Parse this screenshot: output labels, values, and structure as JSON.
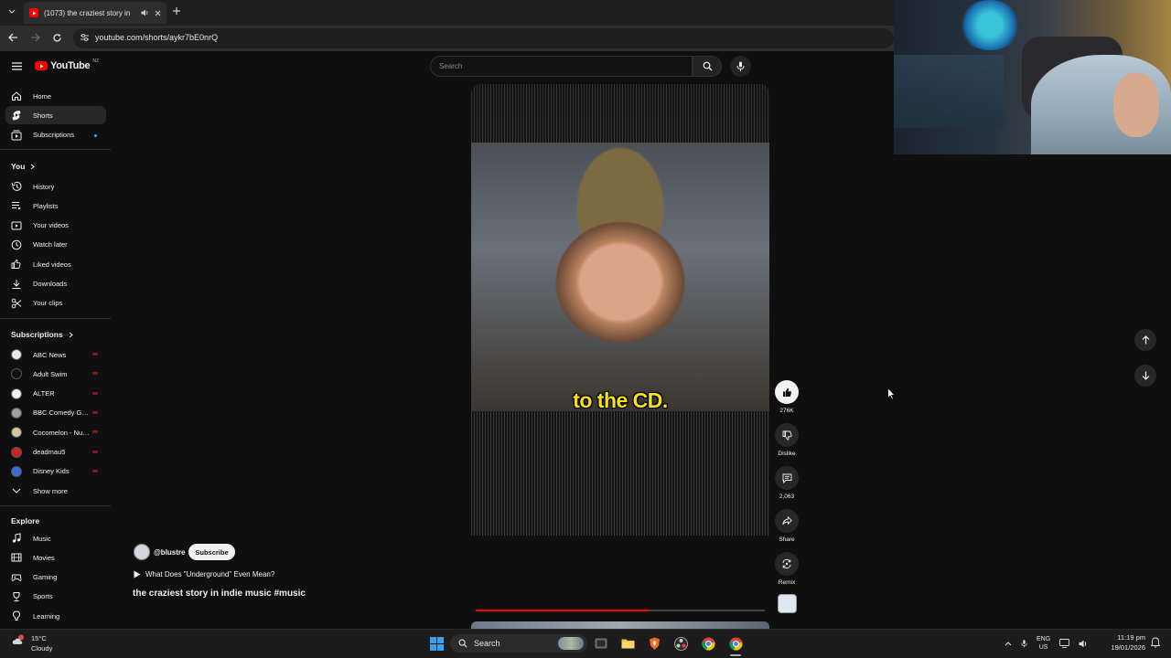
{
  "browser": {
    "tab_title": "(1073) the craziest story in",
    "url": "youtube.com/shorts/aykr7bE0nrQ"
  },
  "youtube": {
    "logo_text": "YouTube",
    "region": "NZ",
    "search_placeholder": "Search"
  },
  "sidebar": {
    "main": [
      {
        "label": "Home",
        "icon": "home-icon"
      },
      {
        "label": "Shorts",
        "icon": "shorts-icon"
      },
      {
        "label": "Subscriptions",
        "icon": "subscriptions-icon"
      }
    ],
    "you_heading": "You",
    "you": [
      {
        "label": "History",
        "icon": "history-icon"
      },
      {
        "label": "Playlists",
        "icon": "playlists-icon"
      },
      {
        "label": "Your videos",
        "icon": "your-videos-icon"
      },
      {
        "label": "Watch later",
        "icon": "watch-later-icon"
      },
      {
        "label": "Liked videos",
        "icon": "liked-videos-icon"
      },
      {
        "label": "Downloads",
        "icon": "downloads-icon"
      },
      {
        "label": "Your clips",
        "icon": "clips-icon"
      }
    ],
    "subscriptions_heading": "Subscriptions",
    "subscriptions": [
      {
        "label": "ABC News",
        "color": "#e8e8e8"
      },
      {
        "label": "Adult Swim",
        "color": "#111111"
      },
      {
        "label": "ALTER",
        "color": "#f1f1f1"
      },
      {
        "label": "BBC Comedy Gre...",
        "color": "#9aa0a6"
      },
      {
        "label": "Cocomelon - Nur...",
        "color": "#d9c4a0"
      },
      {
        "label": "deadmau5",
        "color": "#d0202a"
      },
      {
        "label": "Disney Kids",
        "color": "#3a6fd8"
      }
    ],
    "show_more": "Show more",
    "explore_heading": "Explore",
    "explore": [
      {
        "label": "Music",
        "icon": "music-icon"
      },
      {
        "label": "Movies",
        "icon": "movies-icon"
      },
      {
        "label": "Gaming",
        "icon": "gaming-icon"
      },
      {
        "label": "Sports",
        "icon": "sports-icon"
      },
      {
        "label": "Learning",
        "icon": "learning-icon"
      }
    ]
  },
  "short": {
    "caption": "to the CD.",
    "channel": "@blustre",
    "subscribe": "Subscribe",
    "related": "What Does \"Underground\" Even Mean?",
    "title": "the craziest story in indie music #music",
    "progress": 0.6,
    "actions": {
      "likes": "276K",
      "dislike": "Dislike",
      "comments": "2,063",
      "share": "Share",
      "remix": "Remix"
    }
  },
  "taskbar": {
    "temp": "15°C",
    "weather": "Cloudy",
    "search": "Search",
    "lang_top": "ENG",
    "lang_bottom": "US",
    "time": "11:19 pm",
    "date": "19/01/2026"
  }
}
